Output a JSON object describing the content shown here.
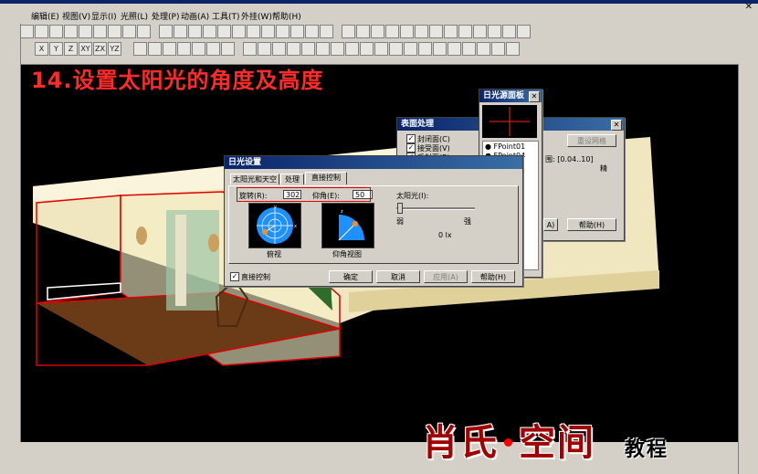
{
  "menu": [
    "编辑(E)",
    "视图(V)",
    "显示(I)",
    "光照(L)",
    "处理(P)",
    "动画(A)",
    "工具(T)",
    "外挂(W)",
    "帮助(H)"
  ],
  "toolbar_axes": [
    "X",
    "Y",
    "Z",
    "XY",
    "ZX",
    "YZ"
  ],
  "headline": "14.设置太阳光的角度及高度",
  "surface_dialog": {
    "title": "表面处理",
    "checks": [
      "封闭面(C)",
      "接受面(V)",
      "反射面(R)"
    ],
    "checked": [
      true,
      true,
      true
    ],
    "range_label": "围: [0.04..10]",
    "preset_button": "重设网格",
    "side_label": "精",
    "btn_a": "A)",
    "help": "帮助(H)"
  },
  "skylight_panel": {
    "title": "日光源面板",
    "items": [
      "FPoint01",
      "FPoint04"
    ]
  },
  "sun_dialog": {
    "title": "日光设置",
    "tabs": [
      "太阳光和天空",
      "处理",
      "直接控制"
    ],
    "rotation_label": "旋转(R):",
    "rotation_value": "302",
    "elevation_label": "仰角(E):",
    "elevation_value": "50",
    "sun_label": "太阳光(I):",
    "weak": "弱",
    "strong": "强",
    "lux": "0 lx",
    "top_view": "俯视",
    "elev_view": "仰角视图",
    "direct_control": "直接控制",
    "direct_checked": true,
    "ok": "确定",
    "cancel": "取消",
    "apply": "应用(A)",
    "help": "帮助(H)"
  },
  "watermark": {
    "main": "肖氏",
    "main2": "空间",
    "sub": "教程"
  },
  "colors": {
    "headline": "#ff2a2a",
    "dialog_title": "#0a246a",
    "highlight_box": "#e00000"
  }
}
